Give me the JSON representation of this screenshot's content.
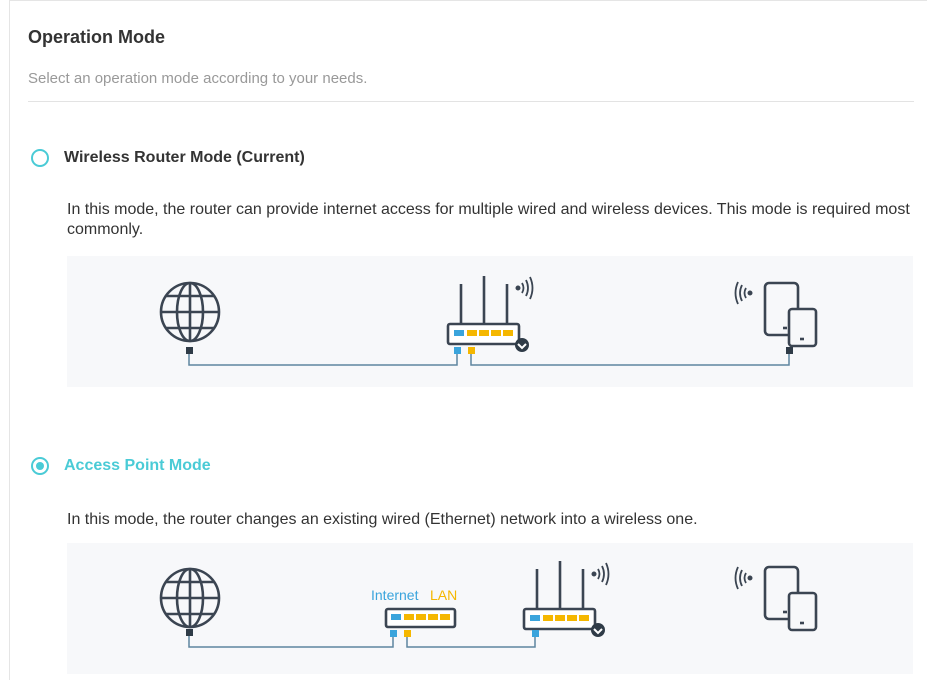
{
  "section": {
    "title": "Operation Mode",
    "subtitle": "Select an operation mode according to your needs."
  },
  "modes": [
    {
      "label": "Wireless Router Mode (Current)",
      "selected": false,
      "description": "In this mode, the router can provide internet access for multiple wired and wireless devices. This mode is required most commonly."
    },
    {
      "label": "Access Point Mode",
      "selected": true,
      "description": "In this mode, the router changes an existing wired (Ethernet) network into a wireless one.",
      "diagram_labels": {
        "internet": "Internet",
        "lan": "LAN"
      }
    }
  ],
  "colors": {
    "accent": "#4acbd6",
    "icon_stroke": "#3b4552",
    "internet_port": "#3aa4dc",
    "lan_port": "#f5b700",
    "cable": "#5f86a0",
    "panel_bg": "#f7f8fa"
  },
  "icons": [
    "globe-icon",
    "router-icon",
    "wifi-signal-icon",
    "tablet-phone-icon",
    "switch-icon"
  ]
}
